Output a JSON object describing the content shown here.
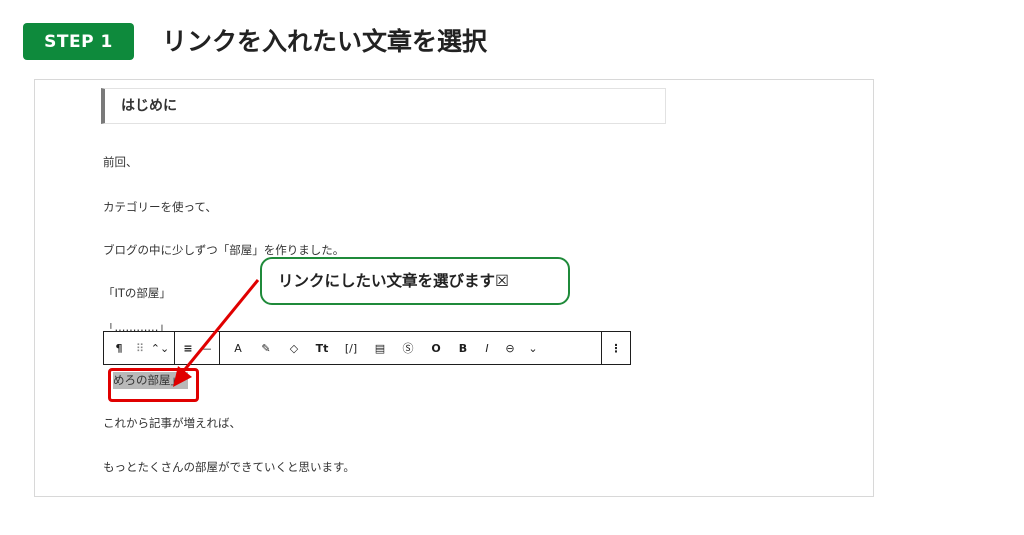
{
  "header": {
    "step_label": "STEP 1",
    "title": "リンクを入れたい文章を選択"
  },
  "editor": {
    "heading": "はじめに",
    "paragraphs": [
      "前回、",
      "カテゴリーを使って、",
      "ブログの中に少しずつ「部屋」を作りました。",
      "「ITの部屋」",
      "「............」",
      "めろの部屋」",
      "これから記事が増えれば、",
      "もっとたくさんの部屋ができていくと思います。"
    ],
    "selected_text": "めろの部屋」"
  },
  "callout": {
    "text": "リンクにしたい文章を選びます☒"
  },
  "toolbar": {
    "paragraph_icon": "¶",
    "drag_icon": "⠿",
    "move_icon": "⌃⌄",
    "align_center_icon": "≡",
    "align_left_icon": "—",
    "text_color_icon": "A",
    "highlight_icon": "✎",
    "tag_icon": "◇",
    "font_size_icon": "Tt",
    "code_icon": "[/]",
    "list_icon": "▤",
    "dollar_icon": "Ⓢ",
    "circle_icon": "O",
    "bold_label": "B",
    "italic_label": "I",
    "link_icon": "⊖",
    "more_dropdown_icon": "⌄",
    "options_icon": "⋮"
  },
  "colors": {
    "accent_green": "#0e8a3c",
    "highlight_red": "#e00000"
  }
}
